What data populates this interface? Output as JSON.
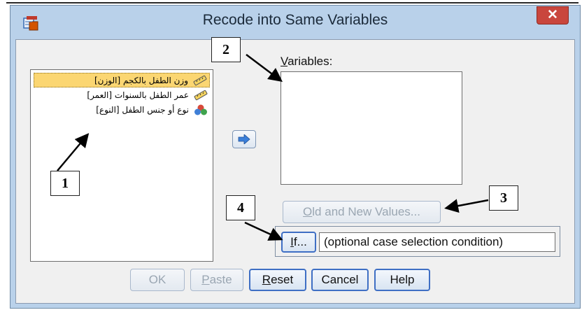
{
  "window": {
    "title": "Recode into Same Variables",
    "close_label": "✕",
    "app_icon": "spss-icon"
  },
  "source_list": {
    "items": [
      {
        "label": "وزن الطفل بالكجم [الوزن]",
        "icon": "ruler-icon",
        "selected": true
      },
      {
        "label": "عمر الطفل بالسنوات [العمر]",
        "icon": "ruler-icon",
        "selected": false
      },
      {
        "label": "نوع أو جنس الطفل [النوع]",
        "icon": "nominal-icon",
        "selected": false
      }
    ]
  },
  "move_button": {
    "icon": "arrow-right-icon"
  },
  "variables": {
    "label_key": "V",
    "label_rest": "ariables:"
  },
  "old_new_button": {
    "key": "O",
    "rest": "ld and New Values..."
  },
  "if_button": {
    "key": "I",
    "rest": "f..."
  },
  "if_condition": "(optional case selection condition)",
  "footer": {
    "ok": "OK",
    "paste_key": "P",
    "paste_rest": "aste",
    "reset_key": "R",
    "reset_rest": "eset",
    "cancel": "Cancel",
    "help": "Help"
  },
  "callouts": {
    "c1": "1",
    "c2": "2",
    "c3": "3",
    "c4": "4"
  },
  "colors": {
    "titlebar": "#b9d1ea",
    "close": "#c9463d",
    "selection": "#fbd672",
    "focus_border": "#3f6fc4"
  }
}
